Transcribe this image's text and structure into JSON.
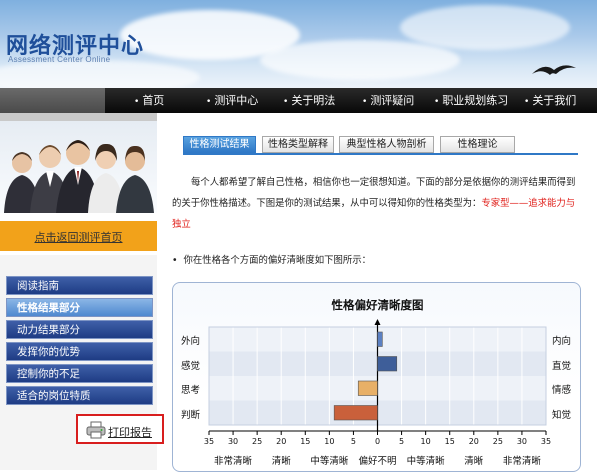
{
  "header": {
    "logo_cn": "网络测评中心",
    "logo_en": "Assessment Center Online"
  },
  "nav": {
    "items": [
      "首页",
      "测评中心",
      "关于明法",
      "测评疑问",
      "职业规划练习",
      "关于我们"
    ]
  },
  "sidebar": {
    "home_link": "点击返回测评首页",
    "menu": [
      "阅读指南",
      "性格结果部分",
      "动力结果部分",
      "发挥你的优势",
      "控制你的不足",
      "适合的岗位特质"
    ],
    "active_index": 1,
    "print_label": "打印报告"
  },
  "tabs": {
    "items": [
      "性格测试结果",
      "性格类型解释",
      "典型性格人物剖析",
      "性格理论"
    ],
    "active_index": 0
  },
  "intro": {
    "text1": "每个人都希望了解自己性格，相信你也一定很想知道。下面的部分是依据你的测评结果而得到的关于你性格描述。下图是你的测试结果，从中可以得知你的性格类型为：",
    "highlight": "专家型——追求能力与独立"
  },
  "bullet_text": "你在性格各个方面的偏好清晰度如下图所示：",
  "colors": {
    "nav_bg": "#111111",
    "sidebar_item": "#1e3c84",
    "sidebar_active": "#4e88cf",
    "tab_active": "#2f78c6",
    "highlight_text": "#e0201b",
    "print_border": "#d81e1e"
  },
  "chart_data": {
    "type": "bar",
    "title": "性格偏好清晰度图",
    "categories": [
      "外向/内向",
      "感觉/直觉",
      "思考/情感",
      "判断/知觉"
    ],
    "left_labels": [
      "外向",
      "感觉",
      "思考",
      "判断"
    ],
    "right_labels": [
      "内向",
      "直觉",
      "情感",
      "知觉"
    ],
    "series": [
      {
        "values": [
          1,
          4,
          -4,
          -9
        ],
        "colors": [
          "#5b80c2",
          "#3e5e99",
          "#e8b067",
          "#c9603b"
        ]
      }
    ],
    "xlim": [
      -35,
      35
    ],
    "ticks": [
      35,
      30,
      25,
      20,
      15,
      10,
      5,
      0,
      5,
      10,
      15,
      20,
      25,
      30,
      35
    ],
    "scale_labels": [
      "非常清晰",
      "清晰",
      "中等清晰",
      "偏好不明",
      "中等清晰",
      "清晰",
      "非常清晰"
    ]
  }
}
